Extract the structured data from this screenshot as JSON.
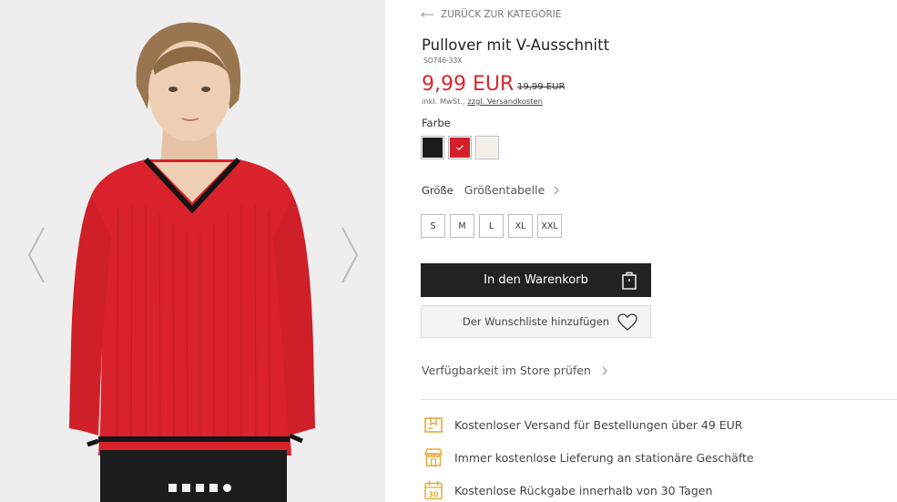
{
  "colors": {
    "accent_red": "#d6282e",
    "dark": "#222222",
    "benefit_icon": "#e8a93a",
    "sweater": "#d9222c"
  },
  "gallery": {
    "prev_icon": "chevron-left-icon",
    "next_icon": "chevron-right-icon",
    "dots_count": 5,
    "active_dot": 5
  },
  "nav": {
    "back_label": "ZURÜCK ZUR KATEGORIE",
    "back_icon": "arrow-left-icon"
  },
  "product": {
    "title": "Pullover mit V-Ausschnitt",
    "sku": "SO746-33X",
    "price": "9,99 EUR",
    "old_price": "19,99 EUR",
    "tax_prefix": "inkl. MwSt.,",
    "shipping_link": "zzgl. Versandkosten"
  },
  "color_picker": {
    "label": "Farbe",
    "options": [
      {
        "name": "black",
        "hex": "#1b1b1b",
        "selected": false
      },
      {
        "name": "red",
        "hex": "#d31f28",
        "selected": true
      },
      {
        "name": "cream",
        "hex": "#f3efe6",
        "selected": false
      }
    ]
  },
  "size_picker": {
    "label": "Größe",
    "chart_label": "Größentabelle",
    "sizes": [
      "S",
      "M",
      "L",
      "XL",
      "XXL"
    ]
  },
  "actions": {
    "cart_label": "In den Warenkorb",
    "cart_icon": "shopping-bag-icon",
    "wishlist_label": "Der Wunschliste hinzufügen",
    "wishlist_icon": "heart-icon"
  },
  "availability": {
    "label": "Verfügbarkeit im Store prüfen"
  },
  "benefits": [
    {
      "icon": "shipping-box-icon",
      "text": "Kostenloser Versand für Bestellungen über 49 EUR"
    },
    {
      "icon": "store-icon",
      "text": "Immer kostenlose Lieferung an stationäre Geschäfte"
    },
    {
      "icon": "calendar-30-icon",
      "text": "Kostenlose Rückgabe innerhalb von 30 Tagen"
    },
    {
      "calendar_number": "30"
    }
  ]
}
